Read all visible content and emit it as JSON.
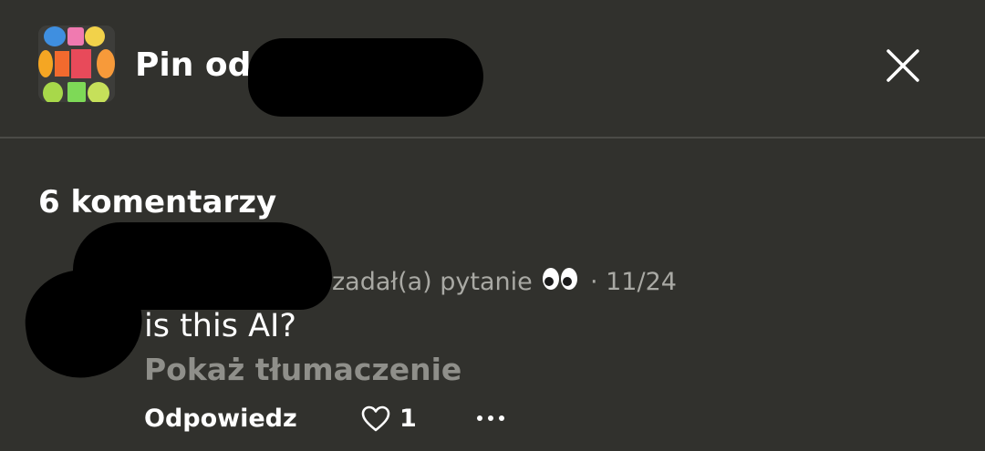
{
  "header": {
    "title_prefix": "Pin od",
    "thumbnail_icon": "colorful-chalk-pin-thumbnail",
    "close_icon": "close-icon"
  },
  "comments": {
    "count_label": "6 komentarzy",
    "items": [
      {
        "action_text": "zadał(a) pytanie",
        "emoji": "👀",
        "separator": "·",
        "date": "11/24",
        "text": "is this AI?",
        "translate_label": "Pokaż tłumaczenie",
        "reply_label": "Odpowiedz",
        "likes": "1"
      }
    ]
  },
  "colors": {
    "background": "#31312d",
    "divider": "#4b4b47",
    "muted_text": "#a9a9a4",
    "translate_text": "#8f8f8a"
  }
}
